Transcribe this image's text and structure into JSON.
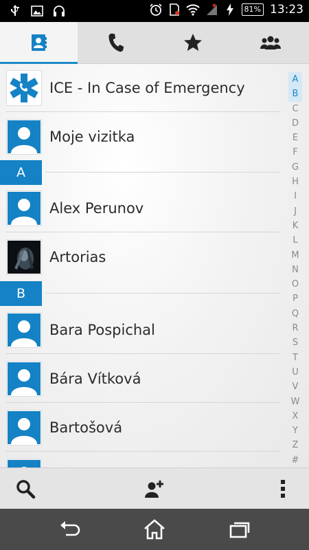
{
  "status_bar": {
    "icons": [
      "usb-icon",
      "image-icon",
      "headphones-icon",
      "alarm-icon",
      "sim-icon",
      "wifi-icon",
      "signal-icon",
      "charging-icon"
    ],
    "battery": "81%",
    "time": "13:23"
  },
  "tabs": [
    {
      "name": "contacts-tab",
      "icon": "contacts-icon",
      "active": true
    },
    {
      "name": "phone-tab",
      "icon": "phone-icon",
      "active": false
    },
    {
      "name": "favorites-tab",
      "icon": "star-icon",
      "active": false
    },
    {
      "name": "groups-tab",
      "icon": "groups-icon",
      "active": false
    }
  ],
  "contacts": {
    "ice": "ICE - In Case of Emergency",
    "my_card": "Moje vizitka",
    "sections": [
      {
        "letter": "A",
        "items": [
          "Alex Perunov",
          "Artorias"
        ]
      },
      {
        "letter": "B",
        "items": [
          "Bara Pospichal",
          "Bára Vítková",
          "Bartošová"
        ]
      }
    ]
  },
  "alphabet_index": [
    "A",
    "B",
    "C",
    "D",
    "E",
    "F",
    "G",
    "H",
    "I",
    "J",
    "K",
    "L",
    "M",
    "N",
    "O",
    "P",
    "Q",
    "R",
    "S",
    "T",
    "U",
    "V",
    "W",
    "X",
    "Y",
    "Z",
    "#"
  ],
  "alphabet_highlight": [
    "A",
    "B"
  ],
  "action_bar": {
    "icons": [
      "search-icon",
      "add-contact-icon",
      "overflow-menu-icon"
    ]
  },
  "nav_bar": {
    "icons": [
      "back-icon",
      "home-icon",
      "recent-apps-icon"
    ]
  },
  "colors": {
    "accent": "#1582c5",
    "avatar": "#1582c5"
  }
}
